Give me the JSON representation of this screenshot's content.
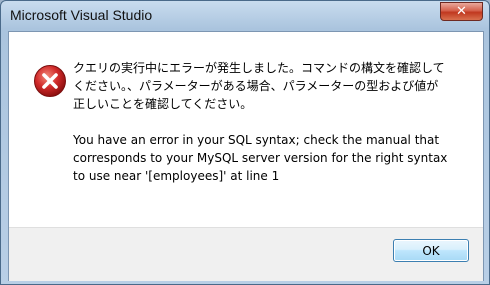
{
  "window": {
    "title": "Microsoft Visual Studio"
  },
  "titlebar": {
    "close_glyph": "✕"
  },
  "dialog": {
    "icon": "error-icon",
    "message_ja": "クエリの実行中にエラーが発生しました。コマンドの構文を確認して\nください。、パラメーターがある場合、パラメーターの型および値が\n正しいことを確認してください。",
    "message_en": "You have an error in your SQL syntax; check the manual that\ncorresponds to your MySQL server version for the right syntax\nto use near '[employees]' at line 1"
  },
  "buttons": {
    "ok_label": "OK"
  },
  "colors": {
    "error_red": "#d12a2a",
    "close_red": "#c0381f",
    "accent_blue": "#3c7fb1"
  }
}
